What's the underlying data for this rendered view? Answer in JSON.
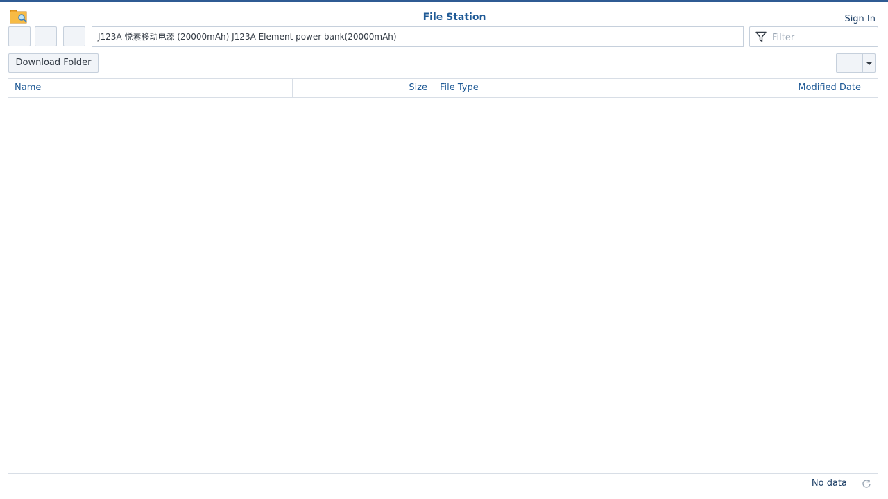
{
  "header": {
    "title": "File Station",
    "sign_in": "Sign In",
    "app_icon": "folder-search-icon"
  },
  "toolbar": {
    "back_icon": "back-icon",
    "forward_icon": "forward-icon",
    "refresh_nav_icon": "refresh-icon",
    "path": "J123A 悦素移动电源 (20000mAh) J123A Element power bank(20000mAh)",
    "filter_placeholder": "Filter",
    "filter_icon": "filter-icon",
    "download_folder_label": "Download Folder"
  },
  "grid": {
    "columns": [
      "Name",
      "Size",
      "File Type",
      "Modified Date"
    ],
    "rows": []
  },
  "footer": {
    "status": "No data",
    "refresh_icon": "refresh-icon"
  },
  "colors": {
    "accent": "#1f5a96",
    "top_border": "#2f5b93",
    "border": "#c6d0dc",
    "folder_icon": "#f0a62c"
  }
}
